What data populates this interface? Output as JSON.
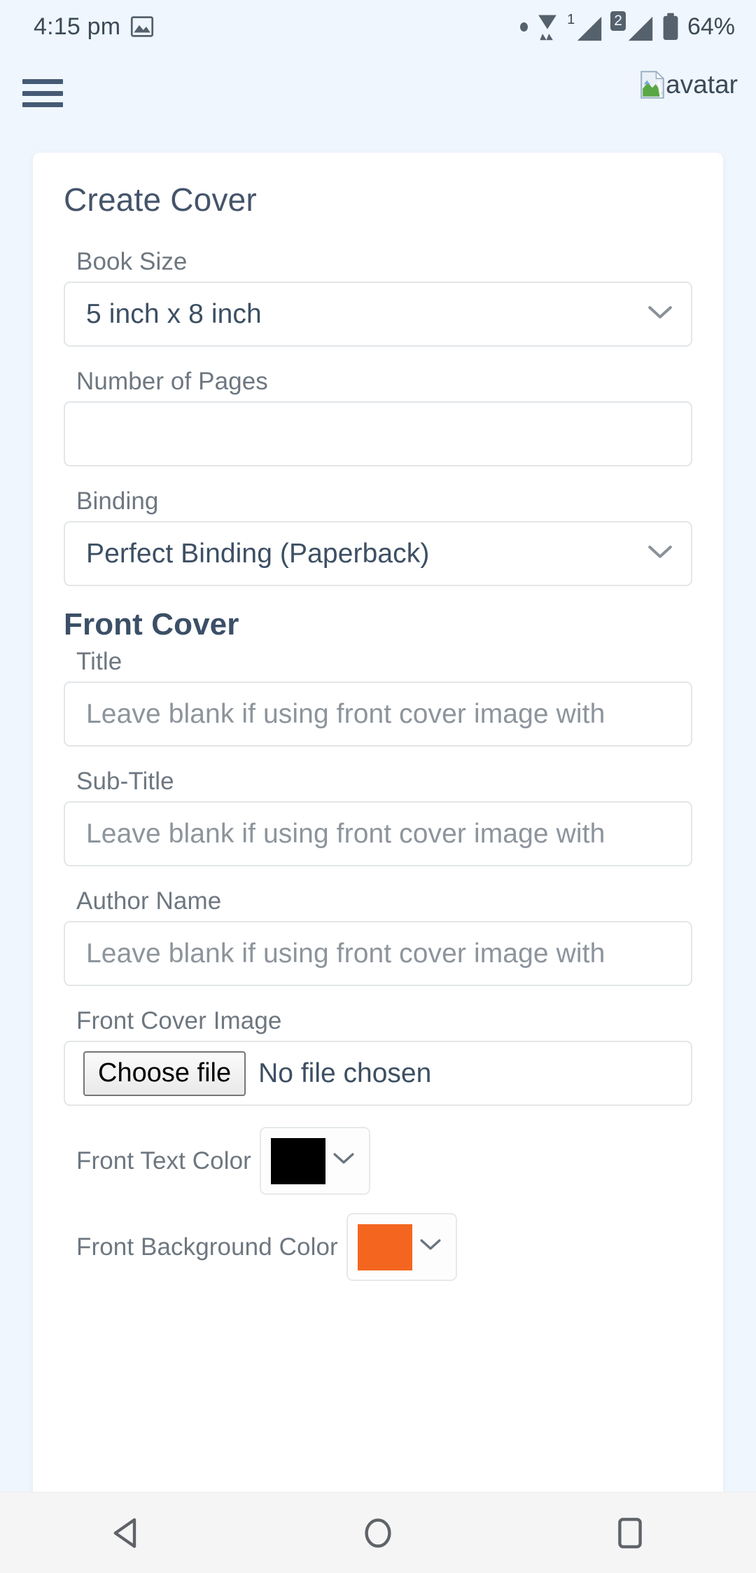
{
  "status_bar": {
    "time": "4:15 pm",
    "image_icon": "image-icon",
    "notification_dot": "dot-indicator",
    "wifi_icon": "wifi-icon",
    "sim1_label": "1",
    "sim1_icon": "signal-bars-icon",
    "sim2_label": "2",
    "sim2_icon": "signal-bars-icon",
    "battery_icon": "battery-icon",
    "battery_text": "64%"
  },
  "header": {
    "menu_icon": "hamburger-menu-icon",
    "avatar_alt": "avatar",
    "avatar_icon": "broken-image-icon"
  },
  "form": {
    "title": "Create Cover",
    "book_size": {
      "label": "Book Size",
      "value": "5 inch x 8 inch",
      "options": [
        "5 inch x 8 inch"
      ],
      "chevron": "chevron-down-icon"
    },
    "number_of_pages": {
      "label": "Number of Pages",
      "value": "",
      "placeholder": ""
    },
    "binding": {
      "label": "Binding",
      "value": "Perfect Binding (Paperback)",
      "options": [
        "Perfect Binding (Paperback)"
      ],
      "chevron": "chevron-down-icon"
    },
    "front_cover_section": "Front Cover",
    "front_title": {
      "label": "Title",
      "value": "",
      "placeholder": "Leave blank if using front cover image with"
    },
    "front_subtitle": {
      "label": "Sub-Title",
      "value": "",
      "placeholder": "Leave blank if using front cover image with"
    },
    "author_name": {
      "label": "Author Name",
      "value": "",
      "placeholder": "Leave blank if using front cover image with"
    },
    "front_cover_image": {
      "label": "Front Cover Image",
      "button_label": "Choose file",
      "file_status": "No file chosen"
    },
    "front_text_color": {
      "label": "Front Text Color",
      "value": "#000000",
      "chevron": "chevron-down-icon"
    },
    "front_background_color": {
      "label": "Front Background Color",
      "value": "#F4661F",
      "chevron": "chevron-down-icon"
    }
  },
  "nav_bar": {
    "back": "back-triangle-icon",
    "home": "home-circle-icon",
    "recents": "recents-square-icon"
  },
  "colors": {
    "page_background": "#EFF6FD",
    "card_background": "#FFFFFF",
    "heading": "#44546A",
    "label": "#6E7780",
    "value_text": "#3D4F63",
    "placeholder": "#8D949C",
    "border": "#E3E6E9",
    "menu": "#455A75",
    "nav_bar_background": "#F5F5F6",
    "nav_icon": "#5F6368"
  }
}
